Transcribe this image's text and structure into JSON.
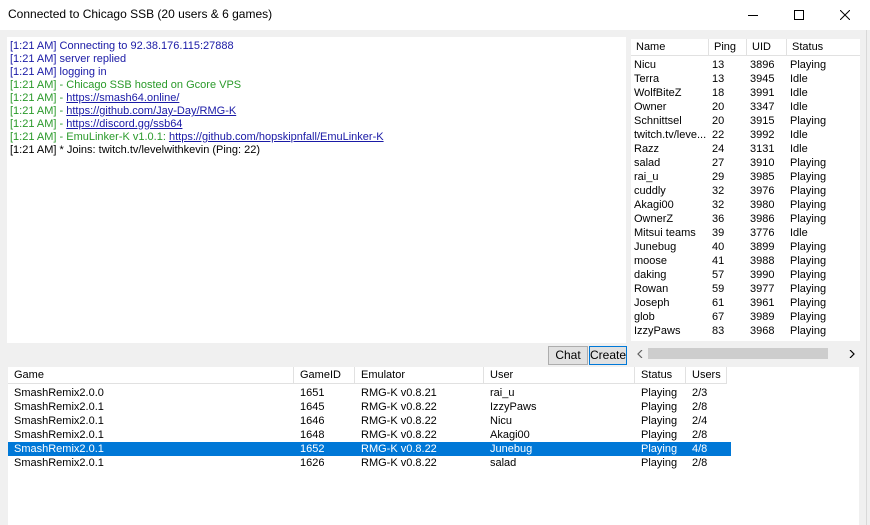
{
  "window": {
    "title": "Connected to Chicago SSB (20 users & 6 games)"
  },
  "chat": {
    "lines": [
      {
        "segments": [
          {
            "text": "[1:21 AM] Connecting to 92.38.176.115:27888",
            "color": "blue",
            "link": false
          }
        ]
      },
      {
        "segments": [
          {
            "text": "[1:21 AM] server replied",
            "color": "blue",
            "link": false
          }
        ]
      },
      {
        "segments": [
          {
            "text": "[1:21 AM] logging in",
            "color": "blue",
            "link": false
          }
        ]
      },
      {
        "segments": [
          {
            "text": "[1:21 AM] - Chicago SSB hosted on Gcore VPS",
            "color": "green",
            "link": false
          }
        ]
      },
      {
        "segments": [
          {
            "text": "[1:21 AM] - ",
            "color": "green",
            "link": false
          },
          {
            "text": "https://smash64.online/",
            "color": "blue",
            "link": true
          }
        ]
      },
      {
        "segments": [
          {
            "text": "[1:21 AM] - ",
            "color": "green",
            "link": false
          },
          {
            "text": "https://github.com/Jay-Day/RMG-K",
            "color": "blue",
            "link": true
          }
        ]
      },
      {
        "segments": [
          {
            "text": "[1:21 AM] - ",
            "color": "green",
            "link": false
          },
          {
            "text": "https://discord.gg/ssb64",
            "color": "blue",
            "link": true
          }
        ]
      },
      {
        "segments": [
          {
            "text": "[1:21 AM] - EmuLinker-K v1.0.1: ",
            "color": "green",
            "link": false
          },
          {
            "text": "https://github.com/hopskipnfall/EmuLinker-K",
            "color": "blue",
            "link": true
          }
        ]
      },
      {
        "segments": [
          {
            "text": "[1:21 AM] * Joins: twitch.tv/levelwithkevin (Ping: 22)",
            "color": "black",
            "link": false
          }
        ]
      }
    ]
  },
  "users": {
    "columns": [
      "Name",
      "Ping",
      "UID",
      "Status"
    ],
    "rows": [
      [
        "Nicu",
        "13",
        "3896",
        "Playing"
      ],
      [
        "Terra",
        "13",
        "3945",
        "Idle"
      ],
      [
        "WolfBiteZ",
        "18",
        "3991",
        "Idle"
      ],
      [
        "Owner",
        "20",
        "3347",
        "Idle"
      ],
      [
        "Schnittsel",
        "20",
        "3915",
        "Playing"
      ],
      [
        "twitch.tv/leve...",
        "22",
        "3992",
        "Idle"
      ],
      [
        "Razz",
        "24",
        "3131",
        "Idle"
      ],
      [
        "salad",
        "27",
        "3910",
        "Playing"
      ],
      [
        "rai_u",
        "29",
        "3985",
        "Playing"
      ],
      [
        "cuddly",
        "32",
        "3976",
        "Playing"
      ],
      [
        "Akagi00",
        "32",
        "3980",
        "Playing"
      ],
      [
        "OwnerZ",
        "36",
        "3986",
        "Playing"
      ],
      [
        "Mitsui teams",
        "39",
        "3776",
        "Idle"
      ],
      [
        "Junebug",
        "40",
        "3899",
        "Playing"
      ],
      [
        "moose",
        "41",
        "3988",
        "Playing"
      ],
      [
        "daking",
        "57",
        "3990",
        "Playing"
      ],
      [
        "Rowan",
        "59",
        "3977",
        "Playing"
      ],
      [
        "Joseph",
        "61",
        "3961",
        "Playing"
      ],
      [
        "glob",
        "67",
        "3989",
        "Playing"
      ],
      [
        "IzzyPaws",
        "83",
        "3968",
        "Playing"
      ]
    ]
  },
  "buttons": {
    "chat": "Chat",
    "create": "Create"
  },
  "games": {
    "columns": [
      "Game",
      "GameID",
      "Emulator",
      "User",
      "Status",
      "Users"
    ],
    "selected_index": 4,
    "rows": [
      [
        "SmashRemix2.0.0",
        "1651",
        "RMG-K v0.8.21",
        "rai_u",
        "Playing",
        "2/3"
      ],
      [
        "SmashRemix2.0.1",
        "1645",
        "RMG-K v0.8.22",
        "IzzyPaws",
        "Playing",
        "2/8"
      ],
      [
        "SmashRemix2.0.1",
        "1646",
        "RMG-K v0.8.22",
        "Nicu",
        "Playing",
        "2/4"
      ],
      [
        "SmashRemix2.0.1",
        "1648",
        "RMG-K v0.8.22",
        "Akagi00",
        "Playing",
        "2/8"
      ],
      [
        "SmashRemix2.0.1",
        "1652",
        "RMG-K v0.8.22",
        "Junebug",
        "Playing",
        "4/8"
      ],
      [
        "SmashRemix2.0.1",
        "1626",
        "RMG-K v0.8.22",
        "salad",
        "Playing",
        "2/8"
      ]
    ]
  },
  "colors": {
    "blue": "#1a1aa6",
    "green": "#2a9a2a",
    "black": "#000000",
    "selection": "#0078d7"
  },
  "icons": {
    "minimize": "minimize-icon",
    "maximize": "maximize-icon",
    "close": "close-icon",
    "scroll_left": "chevron-left-icon",
    "scroll_right": "chevron-right-icon"
  }
}
